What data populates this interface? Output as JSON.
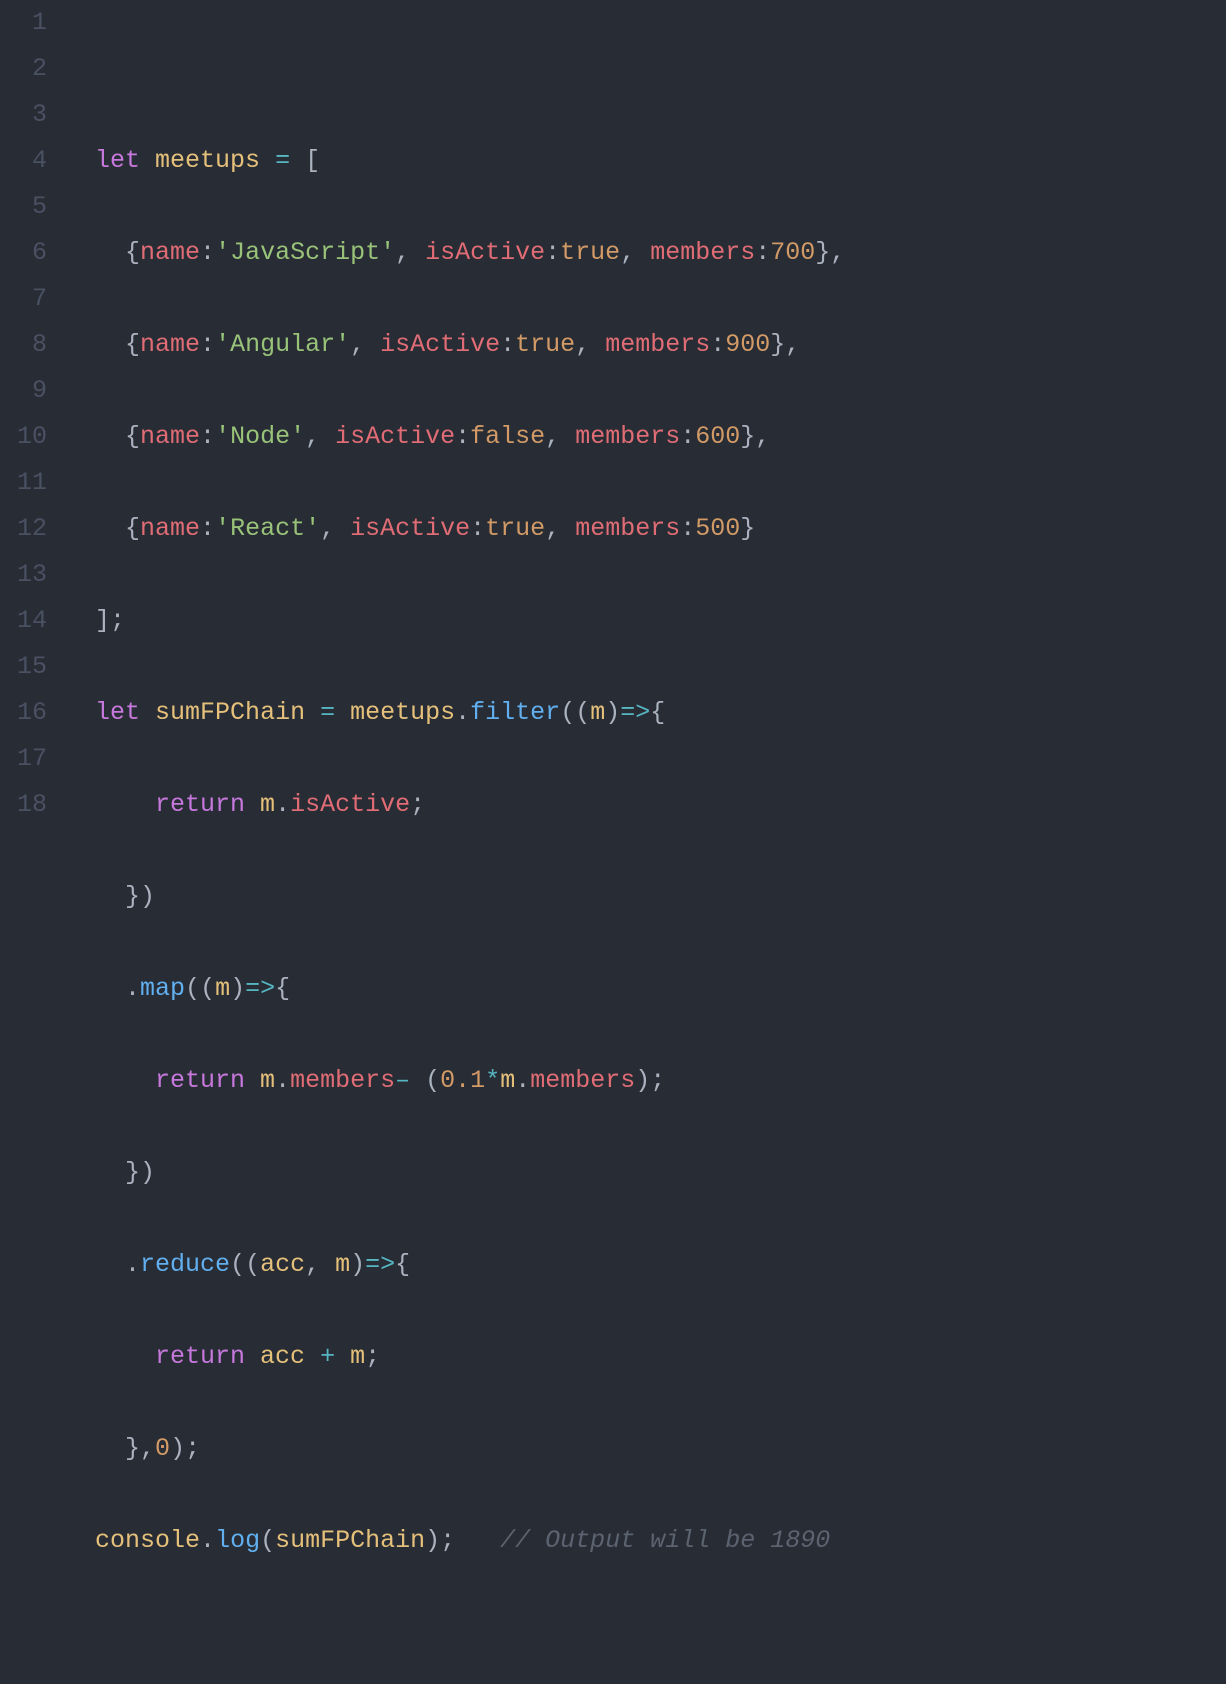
{
  "lineNumbers": [
    "1",
    "2",
    "3",
    "4",
    "5",
    "6",
    "7",
    "8",
    "9",
    "10",
    "11",
    "12",
    "13",
    "14",
    "15",
    "16",
    "17",
    "18"
  ],
  "tokens": {
    "let": "let",
    "return": "return",
    "meetups": "meetups",
    "sumFPChain": "sumFPChain",
    "console": "console",
    "name": "name",
    "isActive": "isActive",
    "members": "members",
    "filter": "filter",
    "map": "map",
    "reduce": "reduce",
    "log": "log",
    "m": "m",
    "acc": "acc",
    "true": "true",
    "false": "false",
    "str_js": "'JavaScript'",
    "str_angular": "'Angular'",
    "str_node": "'Node'",
    "str_react": "'React'",
    "n700": "700",
    "n900": "900",
    "n600": "600",
    "n500": "500",
    "n0": "0",
    "n0_1": "0.1",
    "comment": "// Output will be 1890"
  },
  "punct": {
    "eq": "=",
    "plus": "+",
    "star": "*",
    "arrow": "=>",
    "minus": "–",
    "lbrace": "{",
    "rbrace": "}",
    "lparen": "(",
    "rparen": ")",
    "lbrack": "[",
    "rbrack": "]",
    "comma": ",",
    "colon": ":",
    "semi": ";",
    "dot": "."
  }
}
